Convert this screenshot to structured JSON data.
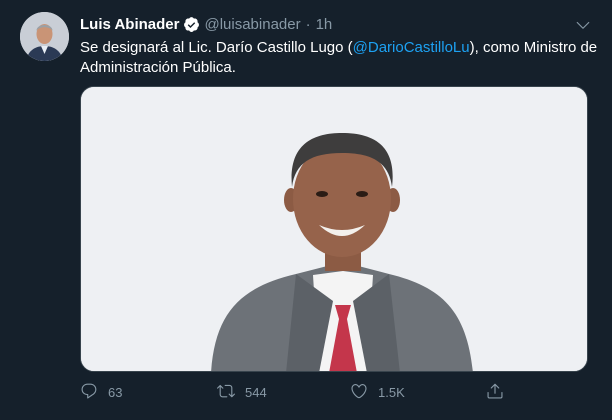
{
  "tweet": {
    "author_name": "Luis Abinader",
    "handle": "@luisabinader",
    "separator": "·",
    "time": "1h",
    "text_before": "Se designará al Lic. Darío Castillo Lugo (",
    "mention": "@DarioCastilloLu",
    "text_after": "), como Ministro de Administración Pública.",
    "verified": true
  },
  "actions": {
    "replies": "63",
    "retweets": "544",
    "likes": "1.5K"
  },
  "icons": {
    "verified": "verified-badge-icon",
    "menu": "chevron-down-icon",
    "reply": "reply-icon",
    "retweet": "retweet-icon",
    "like": "heart-icon",
    "share": "share-icon"
  },
  "colors": {
    "background": "#15202b",
    "text": "#ffffff",
    "secondary": "#8899a6",
    "accent": "#1da1f2"
  }
}
